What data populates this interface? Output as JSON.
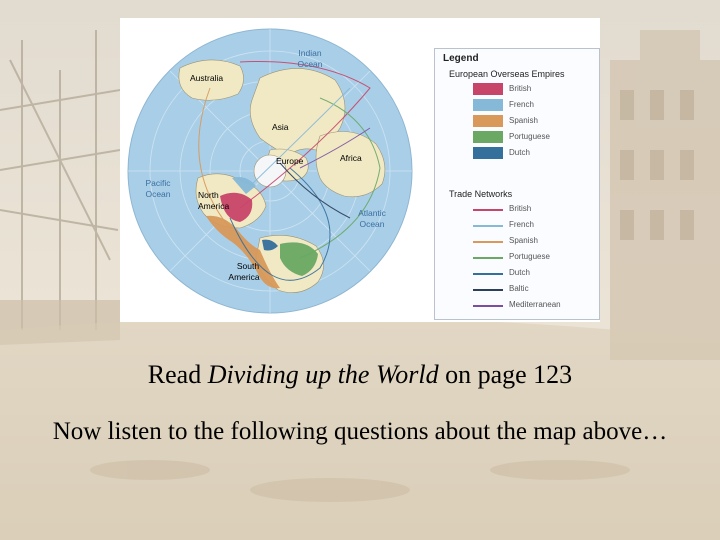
{
  "slide": {
    "caption_pre": "Read ",
    "caption_italic": "Dividing up the World",
    "caption_post": " on page 123",
    "caption_line2": "Now listen to the following questions about the map above…"
  },
  "map": {
    "labels": {
      "indian_ocean": [
        "Indian",
        "Ocean"
      ],
      "australia": "Australia",
      "asia": "Asia",
      "europe": "Europe",
      "africa": "Africa",
      "pacific_ocean": [
        "Pacific",
        "Ocean"
      ],
      "north_america": [
        "North",
        "America"
      ],
      "atlantic_ocean": [
        "Atlantic",
        "Ocean"
      ],
      "south_america": [
        "South",
        "America"
      ]
    },
    "colors": {
      "ocean": "#a9cfe8",
      "land": "#f1e9c4",
      "british": "#c8456a",
      "french": "#86b8d8",
      "spanish": "#d8995a",
      "portuguese": "#6aa864",
      "dutch": "#356f9c"
    }
  },
  "legend": {
    "title": "Legend",
    "empires_title": "European Overseas Empires",
    "empires": [
      {
        "label": "British",
        "color": "#c8456a"
      },
      {
        "label": "French",
        "color": "#86b8d8"
      },
      {
        "label": "Spanish",
        "color": "#d8995a"
      },
      {
        "label": "Portuguese",
        "color": "#6aa864"
      },
      {
        "label": "Dutch",
        "color": "#356f9c"
      }
    ],
    "networks_title": "Trade Networks",
    "networks": [
      {
        "label": "British",
        "color": "#c8456a"
      },
      {
        "label": "French",
        "color": "#86b8d8"
      },
      {
        "label": "Spanish",
        "color": "#d8995a"
      },
      {
        "label": "Portuguese",
        "color": "#6aa864"
      },
      {
        "label": "Dutch",
        "color": "#356f9c"
      },
      {
        "label": "Baltic",
        "color": "#2a3f5a"
      },
      {
        "label": "Mediterranean",
        "color": "#7a4fa0"
      }
    ]
  }
}
